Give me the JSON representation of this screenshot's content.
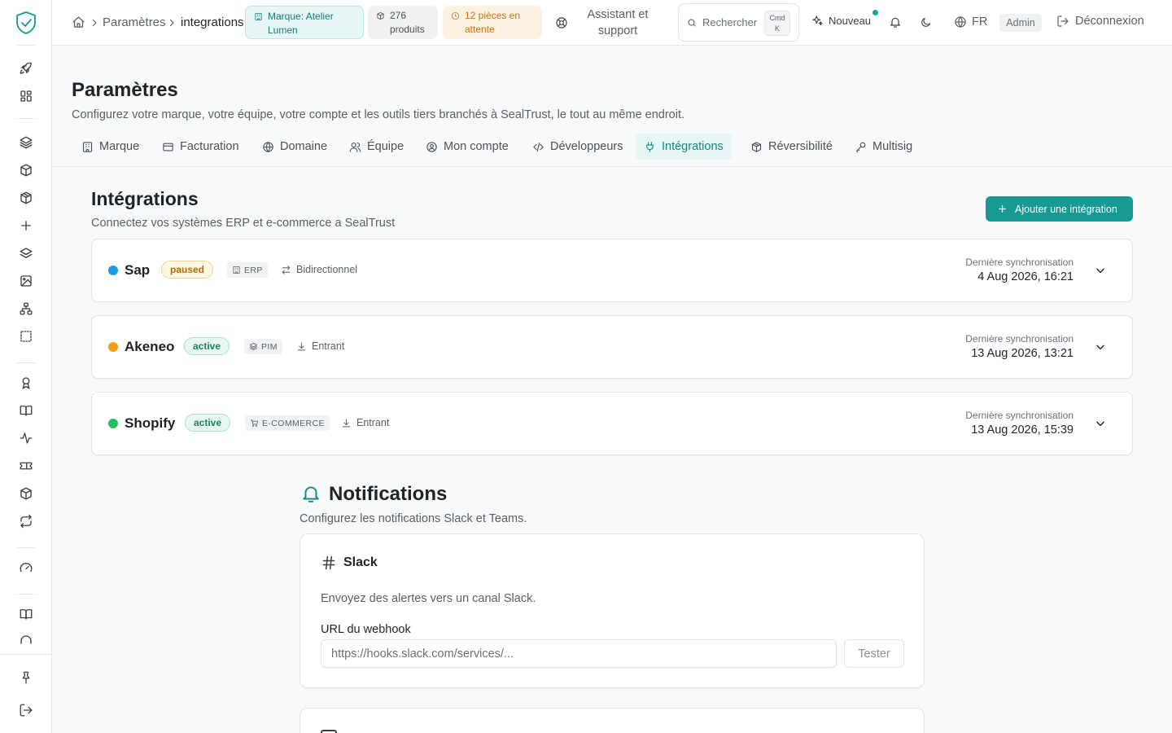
{
  "topbar": {
    "breadcrumb": [
      "Paramètres",
      "integrations"
    ],
    "chips": {
      "brand": "Marque: Atelier Lumen",
      "products": "276 produits",
      "pending": "12 pièces en attente"
    },
    "assistant": "Assistant et support",
    "search": {
      "label": "Rechercher",
      "kbd_1": "Cmd",
      "kbd_2": "K"
    },
    "new_label": "Nouveau",
    "language": "FR",
    "role": "Admin",
    "logout": "Déconnexion"
  },
  "page": {
    "title": "Paramètres",
    "subtitle": "Configurez votre marque, votre équipe, votre compte et les outils tiers branchés à SealTrust, le tout au même endroit."
  },
  "tabs": [
    {
      "label": "Marque",
      "icon": "building-icon"
    },
    {
      "label": "Facturation",
      "icon": "credit-card-icon"
    },
    {
      "label": "Domaine",
      "icon": "globe-icon"
    },
    {
      "label": "Équipe",
      "icon": "users-icon"
    },
    {
      "label": "Mon compte",
      "icon": "user-circle-icon"
    },
    {
      "label": "Développeurs",
      "icon": "code-icon"
    },
    {
      "label": "Intégrations",
      "icon": "plug-icon",
      "active": true
    },
    {
      "label": "Réversibilité",
      "icon": "package-icon"
    },
    {
      "label": "Multisig",
      "icon": "key-icon"
    }
  ],
  "integrations": {
    "title": "Intégrations",
    "subtitle": "Connectez vos systèmes ERP et e-commerce a SealTrust",
    "add_label": "Ajouter une intégration",
    "items": [
      {
        "name": "Sap",
        "dot_color": "#1c9be6",
        "status": "paused",
        "type": "ERP",
        "direction": "Bidirectionnel",
        "sync_label": "Dernière synchronisation",
        "sync_date": "4 Aug 2026, 16:21"
      },
      {
        "name": "Akeneo",
        "dot_color": "#f39c1a",
        "status": "active",
        "type": "PIM",
        "direction": "Entrant",
        "sync_label": "Dernière synchronisation",
        "sync_date": "13 Aug 2026, 13:21"
      },
      {
        "name": "Shopify",
        "dot_color": "#1fbf5a",
        "status": "active",
        "type": "E-COMMERCE",
        "direction": "Entrant",
        "sync_label": "Dernière synchronisation",
        "sync_date": "13 Aug 2026, 15:39"
      }
    ]
  },
  "notifications": {
    "title": "Notifications",
    "subtitle": "Configurez les notifications Slack et Teams.",
    "slack": {
      "name": "Slack",
      "description": "Envoyez des alertes vers un canal Slack.",
      "webhook_label": "URL du webhook",
      "webhook_placeholder": "https://hooks.slack.com/services/...",
      "test_label": "Tester"
    }
  },
  "colors": {
    "accent": "#179a93",
    "accent_light": "#e6f6f4",
    "paused": "#b56a05",
    "active": "#17855a"
  }
}
